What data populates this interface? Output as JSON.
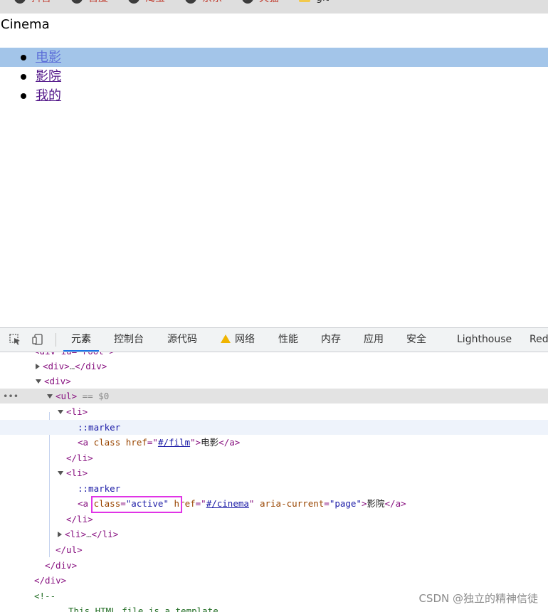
{
  "bookmarks": [
    {
      "label": "抖音",
      "icon": "globe-icon"
    },
    {
      "label": "百度",
      "icon": "globe-icon"
    },
    {
      "label": "淘宝",
      "icon": "globe-icon"
    },
    {
      "label": "京东",
      "icon": "globe-icon"
    },
    {
      "label": "天猫",
      "icon": "globe-icon"
    },
    {
      "label": "git",
      "icon": "folder-icon"
    }
  ],
  "page": {
    "heading": "Cinema",
    "nav": [
      {
        "label": "电影"
      },
      {
        "label": "影院"
      },
      {
        "label": "我的"
      }
    ]
  },
  "devtools": {
    "tabs": [
      "元素",
      "控制台",
      "源代码",
      "网络",
      "性能",
      "内存",
      "应用",
      "安全",
      "Lighthouse",
      "Red"
    ],
    "active_tab": "元素",
    "tree": {
      "row0": "<div id=\"root\">",
      "row1_tag": "<div>",
      "row1_ellipsis": "…",
      "row1_close": "</div>",
      "row2": "<div>",
      "row3_tag": "<ul>",
      "row3_eq": " == $0",
      "li_open": "<li>",
      "marker": "::marker",
      "a_open": "<a",
      "attr_class": "class",
      "attr_href": "href",
      "href_film": "#/film",
      "text_film": "电影",
      "a_close": "</a>",
      "li_close": "</li>",
      "class_active_val": "\"active\"",
      "href_cinema": "#/cinema",
      "attr_aria": "aria-current",
      "aria_val": "\"page\"",
      "text_cinema": "影院",
      "li_ellipsis": "…",
      "ul_close": "</ul>",
      "div_close": "</div>",
      "comment_open": "<!--",
      "comment_text": "This HTML file is a template."
    }
  },
  "watermark": "CSDN @独立的精神信徒"
}
